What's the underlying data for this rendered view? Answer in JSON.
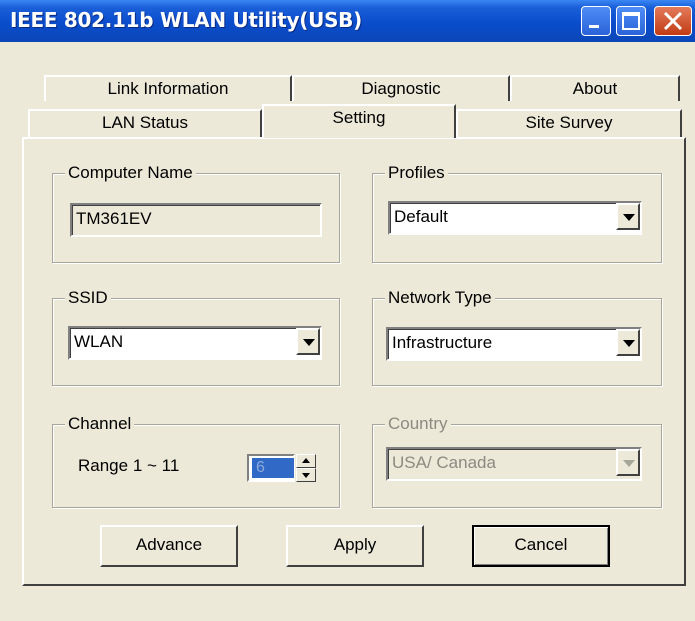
{
  "window": {
    "title": "IEEE 802.11b WLAN Utility(USB)"
  },
  "tabs": {
    "link_information": "Link Information",
    "diagnostic": "Diagnostic",
    "about": "About",
    "lan_status": "LAN Status",
    "setting": "Setting",
    "site_survey": "Site Survey",
    "active": "Setting"
  },
  "computer_name": {
    "label": "Computer Name",
    "value": "TM361EV"
  },
  "profiles": {
    "label": "Profiles",
    "selected": "Default"
  },
  "ssid": {
    "label": "SSID",
    "selected": "WLAN"
  },
  "network_type": {
    "label": "Network Type",
    "selected": "Infrastructure"
  },
  "channel": {
    "label": "Channel",
    "range_text": "Range 1 ~ 11",
    "value": "6"
  },
  "country": {
    "label": "Country",
    "selected": "USA/ Canada",
    "enabled": false
  },
  "buttons": {
    "advance": "Advance",
    "apply": "Apply",
    "cancel": "Cancel"
  },
  "icons": {
    "minimize": "minimize-icon",
    "maximize": "maximize-icon",
    "close": "close-icon",
    "dropdown": "chevron-down-icon"
  },
  "colors": {
    "titlebar": "#0a4ccc",
    "window_bg": "#ece9d8",
    "close_button": "#c23b14",
    "selection": "#3169c6"
  }
}
